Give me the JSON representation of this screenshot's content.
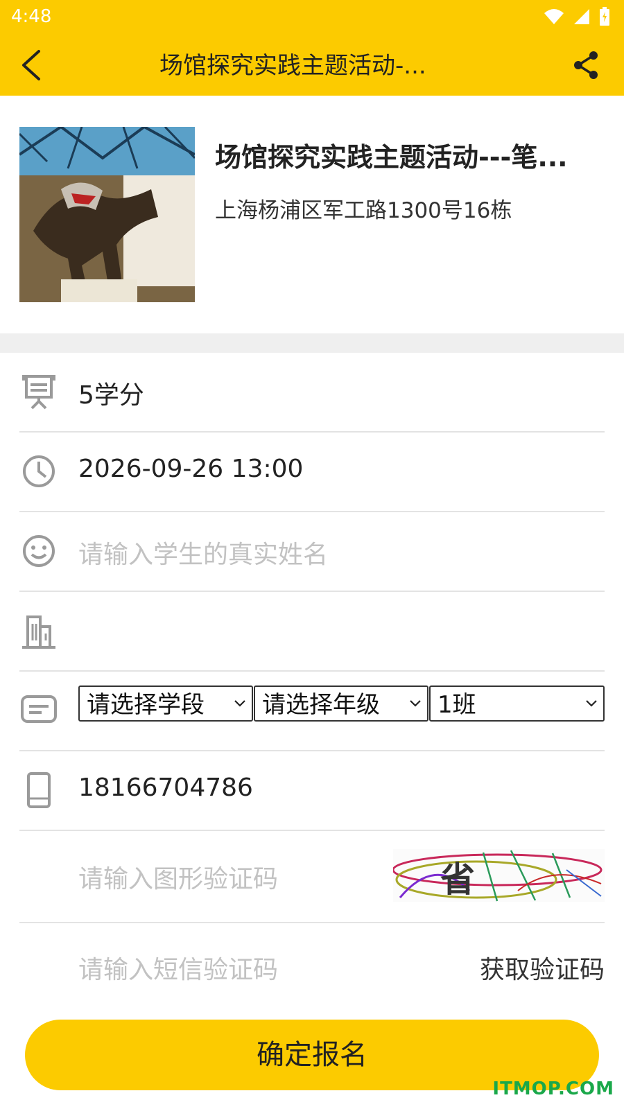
{
  "status_bar": {
    "time": "4:48"
  },
  "app_bar": {
    "title": "场馆探究实践主题活动-..."
  },
  "activity": {
    "title": "场馆探究实践主题活动---笔...",
    "address": "上海杨浦区军工路1300号16栋"
  },
  "form": {
    "credit": "5学分",
    "datetime": "2026-09-26 13:00",
    "name_placeholder": "请输入学生的真实姓名",
    "school_value": "",
    "stage_select": "请选择学段",
    "grade_select": "请选择年级",
    "class_select": "1班",
    "phone": "18166704786",
    "captcha_placeholder": "请输入图形验证码",
    "captcha_char": "省",
    "sms_placeholder": "请输入短信验证码",
    "get_code_label": "获取验证码",
    "submit_label": "确定报名"
  },
  "watermark": "ITMOP.COM",
  "colors": {
    "accent": "#fccb00",
    "divider": "#e3e3e3",
    "placeholder": "#c2c2c2"
  }
}
